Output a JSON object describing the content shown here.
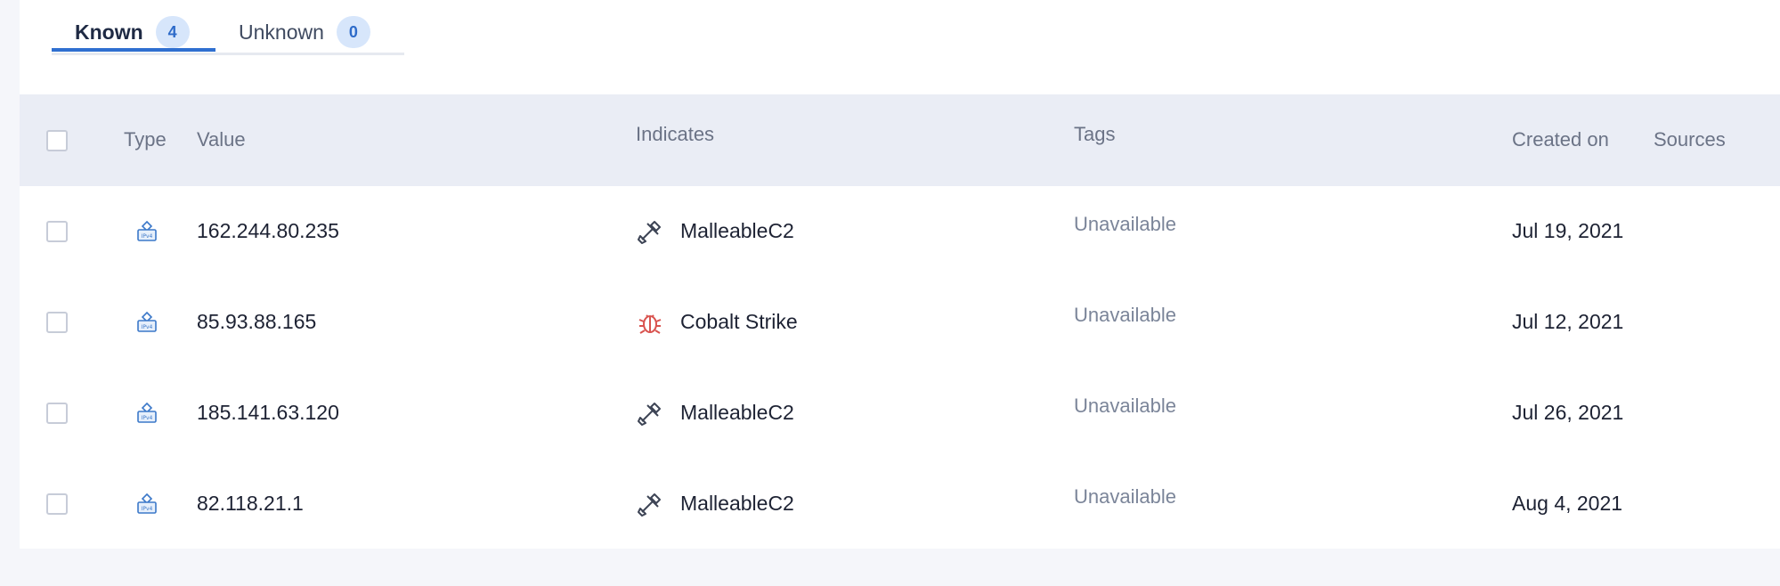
{
  "tabs": [
    {
      "label": "Known",
      "count": "4"
    },
    {
      "label": "Unknown",
      "count": "0"
    }
  ],
  "table": {
    "headers": {
      "type": "Type",
      "value": "Value",
      "indicates": "Indicates",
      "tags": "Tags",
      "created_on": "Created on",
      "sources": "Sources"
    },
    "rows": [
      {
        "value": "162.244.80.235",
        "indicates": "MalleableC2",
        "indicates_icon": "tools-icon",
        "tags": "Unavailable",
        "created_on": "Jul 19, 2021"
      },
      {
        "value": "85.93.88.165",
        "indicates": "Cobalt Strike",
        "indicates_icon": "bug-icon",
        "tags": "Unavailable",
        "created_on": "Jul 12, 2021"
      },
      {
        "value": "185.141.63.120",
        "indicates": "MalleableC2",
        "indicates_icon": "tools-icon",
        "tags": "Unavailable",
        "created_on": "Jul 26, 2021"
      },
      {
        "value": "82.118.21.1",
        "indicates": "MalleableC2",
        "indicates_icon": "tools-icon",
        "tags": "Unavailable",
        "created_on": "Aug 4, 2021"
      }
    ]
  },
  "colors": {
    "accent": "#2f6fd0",
    "bug": "#d9534f",
    "ip_icon": "#3b78c9"
  }
}
